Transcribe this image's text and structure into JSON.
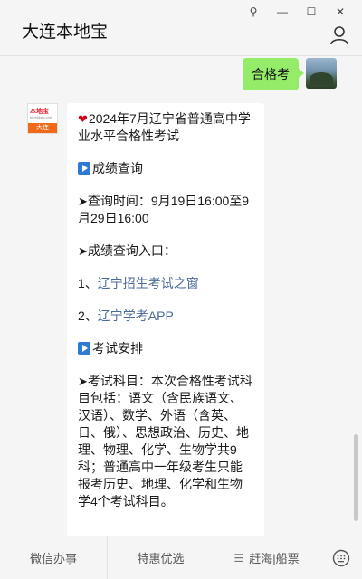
{
  "header": {
    "title": "大连本地宝",
    "controls": {
      "pin": "⚲",
      "minimize": "—",
      "maximize": "☐",
      "close": "✕"
    }
  },
  "chat": {
    "my_message": "合格考",
    "bot_avatar": {
      "logo_text": "本地宝",
      "logo_sub": "bendibao.com",
      "city": "大连"
    },
    "bot_message": {
      "title": "2024年7月辽宁省普通高中学业水平合格性考试",
      "section1": "成绩查询",
      "query_time": "查询时间：9月19日16:00至9月29日16:00",
      "query_entry": "成绩查询入口：",
      "link1_prefix": "1、",
      "link1": "辽宁招生考试之窗",
      "link2_prefix": "2、",
      "link2": "辽宁学考APP",
      "section2": "考试安排",
      "subjects": "考试科目：本次合格性考试科目包括：语文（含民族语文、汉语）、数学、外语（含英、日、俄）、思想政治、历史、地理、物理、化学、生物学共9科；普通高中一年级考生只能报考历史、地理、化学和生物学4个考试科目。"
    }
  },
  "menu": {
    "items": [
      "微信办事",
      "特惠优选",
      "赶海|船票"
    ]
  },
  "colors": {
    "my_bubble": "#95ec69",
    "link": "#4a6a99",
    "play_icon": "#2f7bd4"
  }
}
